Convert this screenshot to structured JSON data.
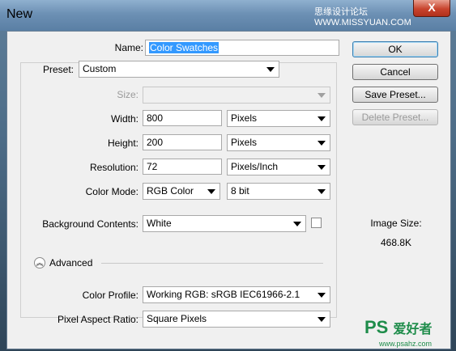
{
  "window": {
    "title": "New",
    "watermark_top": "思缘设计论坛  WWW.MISSYUAN.COM",
    "close_glyph": "X"
  },
  "form": {
    "name_label": "Name:",
    "name_value": "Color Swatches",
    "preset_label": "Preset:",
    "preset_value": "Custom",
    "size_label": "Size:",
    "size_value": "",
    "width_label": "Width:",
    "width_value": "800",
    "width_unit": "Pixels",
    "height_label": "Height:",
    "height_value": "200",
    "height_unit": "Pixels",
    "resolution_label": "Resolution:",
    "resolution_value": "72",
    "resolution_unit": "Pixels/Inch",
    "color_mode_label": "Color Mode:",
    "color_mode_value": "RGB Color",
    "bit_depth_value": "8 bit",
    "background_label": "Background Contents:",
    "background_value": "White",
    "advanced_label": "Advanced",
    "color_profile_label": "Color Profile:",
    "color_profile_value": "Working RGB:  sRGB IEC61966-2.1",
    "pixel_aspect_label": "Pixel Aspect Ratio:",
    "pixel_aspect_value": "Square Pixels"
  },
  "buttons": {
    "ok": "OK",
    "cancel": "Cancel",
    "save_preset": "Save Preset...",
    "delete_preset": "Delete Preset..."
  },
  "image_size": {
    "label": "Image Size:",
    "value": "468.8K"
  },
  "logo": {
    "text": "PS",
    "cn": "爱好者",
    "url": "www.psahz.com"
  }
}
